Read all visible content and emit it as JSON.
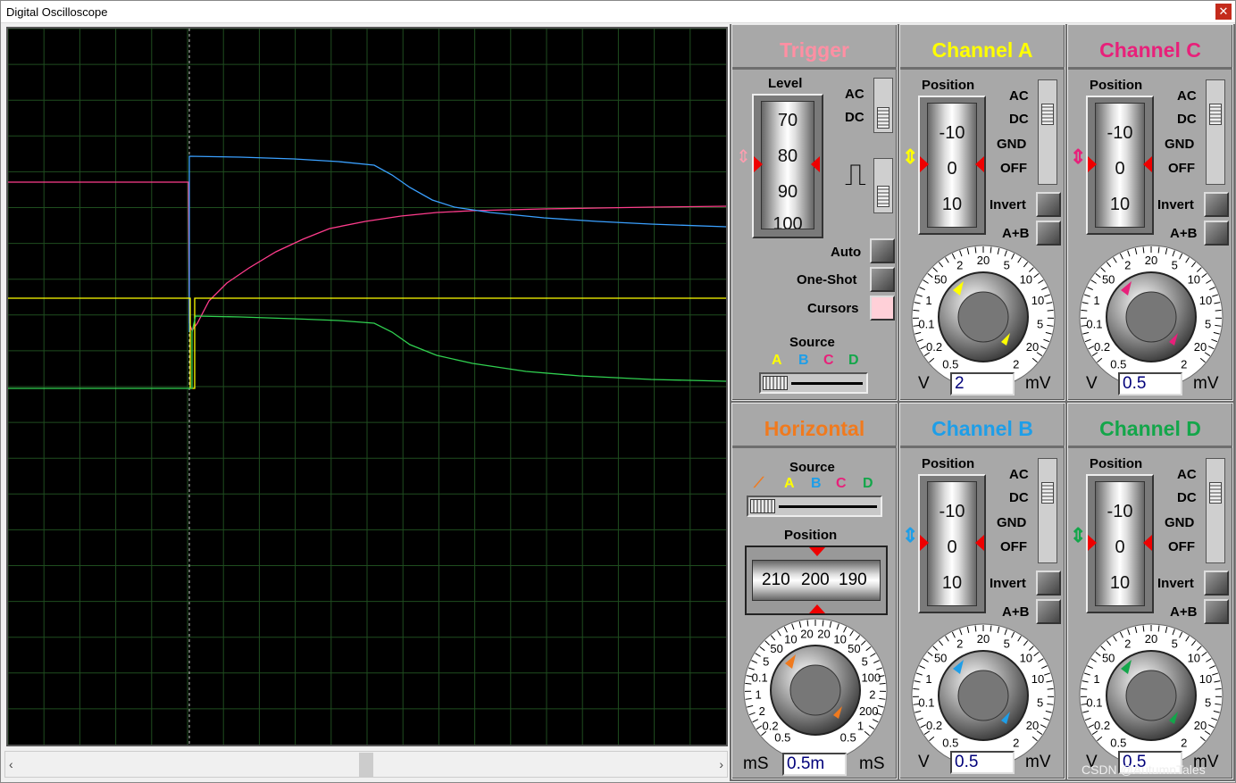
{
  "window": {
    "title": "Digital Oscilloscope",
    "close_icon": "close-icon"
  },
  "colors": {
    "trigger": "#ff8fa3",
    "channel_a": "#ffff00",
    "channel_c": "#e8207a",
    "horizontal": "#f07a1e",
    "channel_b": "#1e9ee8",
    "channel_d": "#13a64a",
    "trace_a": "#ffff00",
    "trace_b": "#3aa0ff",
    "trace_c": "#ff3c8c",
    "trace_d": "#30d050",
    "grid": "#1f4d1f"
  },
  "trigger": {
    "title": "Trigger",
    "level_label": "Level",
    "level_values": [
      "70",
      "80",
      "90",
      "100"
    ],
    "ac": "AC",
    "dc": "DC",
    "auto": "Auto",
    "one_shot": "One-Shot",
    "cursors": "Cursors",
    "source_label": "Source",
    "sources": [
      "A",
      "B",
      "C",
      "D"
    ]
  },
  "channel_a": {
    "title": "Channel A",
    "position_label": "Position",
    "pos_values": [
      "-10",
      "0",
      "10"
    ],
    "ac": "AC",
    "dc": "DC",
    "gnd": "GND",
    "off": "OFF",
    "invert": "Invert",
    "aplusb": "A+B",
    "dial": [
      "0.5",
      "0.2",
      "0.1",
      "1",
      "50",
      "2",
      "20",
      "5",
      "10",
      "10",
      "5",
      "20",
      "2"
    ],
    "unit_left": "V",
    "unit_right": "mV",
    "value": "2"
  },
  "channel_c": {
    "title": "Channel C",
    "position_label": "Position",
    "pos_values": [
      "-10",
      "0",
      "10"
    ],
    "ac": "AC",
    "dc": "DC",
    "gnd": "GND",
    "off": "OFF",
    "invert": "Invert",
    "aplusb": "A+B",
    "dial": [
      "0.5",
      "0.2",
      "0.1",
      "1",
      "50",
      "2",
      "20",
      "5",
      "10",
      "10",
      "5",
      "20",
      "2"
    ],
    "unit_left": "V",
    "unit_right": "mV",
    "value": "0.5"
  },
  "horizontal": {
    "title": "Horizontal",
    "source_label": "Source",
    "sources": [
      "A",
      "B",
      "C",
      "D"
    ],
    "position_label": "Position",
    "pos_values": [
      "210",
      "200",
      "190"
    ],
    "dial": [
      "0.5",
      "0.2",
      "2",
      "1",
      "0.1",
      "5",
      "50",
      "10",
      "20",
      "20",
      "10",
      "50",
      "5",
      "100",
      "2",
      "200",
      "1",
      "0.5"
    ],
    "unit_left": "mS",
    "unit_right": "mS",
    "value": "0.5m"
  },
  "channel_b": {
    "title": "Channel B",
    "position_label": "Position",
    "pos_values": [
      "-10",
      "0",
      "10"
    ],
    "ac": "AC",
    "dc": "DC",
    "gnd": "GND",
    "off": "OFF",
    "invert": "Invert",
    "aplusb": "A+B",
    "dial": [
      "0.5",
      "0.2",
      "0.1",
      "1",
      "50",
      "2",
      "20",
      "5",
      "10",
      "10",
      "5",
      "20",
      "2"
    ],
    "unit_left": "V",
    "unit_right": "mV",
    "value": "0.5"
  },
  "channel_d": {
    "title": "Channel D",
    "position_label": "Position",
    "pos_values": [
      "-10",
      "0",
      "10"
    ],
    "ac": "AC",
    "dc": "DC",
    "gnd": "GND",
    "off": "OFF",
    "invert": "Invert",
    "aplusb": "A+B",
    "dial": [
      "0.5",
      "0.2",
      "0.1",
      "1",
      "50",
      "2",
      "20",
      "5",
      "10",
      "10",
      "5",
      "20",
      "2"
    ],
    "unit_left": "V",
    "unit_right": "mV",
    "value": "0.5"
  },
  "watermark": "CSDN @AutumnTales"
}
